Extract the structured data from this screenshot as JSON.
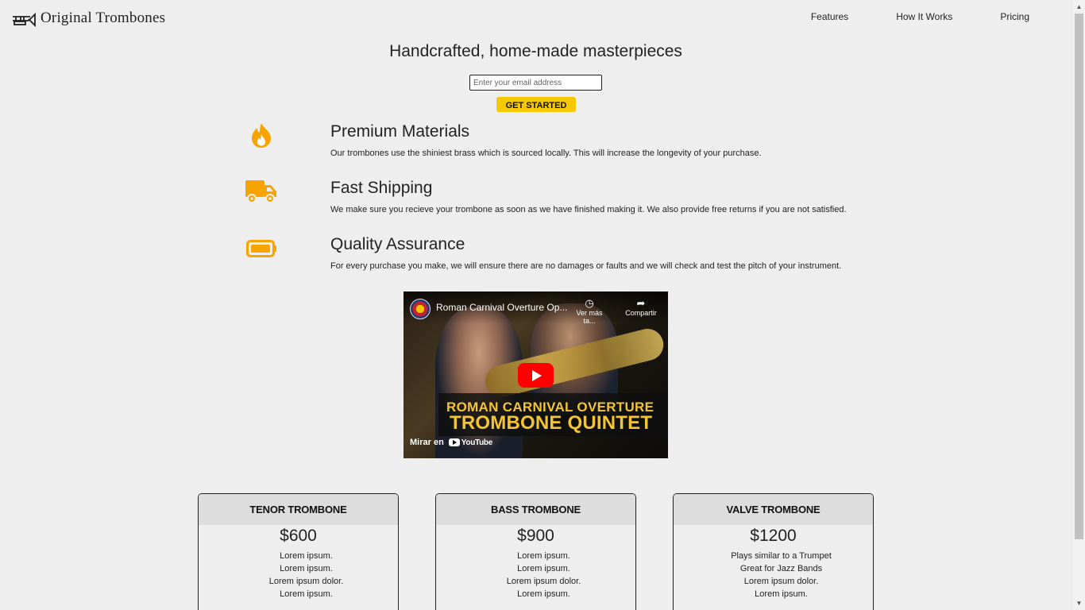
{
  "header": {
    "brand": "Original Trombones",
    "logo_icon": "trombone-icon",
    "nav": [
      {
        "label": "Features"
      },
      {
        "label": "How It Works"
      },
      {
        "label": "Pricing"
      }
    ]
  },
  "hero": {
    "title": "Handcrafted, home-made masterpieces",
    "email_placeholder": "Enter your email address",
    "cta_label": "GET STARTED"
  },
  "features": [
    {
      "icon": "fire-icon",
      "title": "Premium Materials",
      "description": "Our trombones use the shiniest brass which is sourced locally. This will increase the longevity of your purchase."
    },
    {
      "icon": "truck-icon",
      "title": "Fast Shipping",
      "description": "We make sure you recieve your trombone as soon as we have finished making it. We also provide free returns if you are not satisfied."
    },
    {
      "icon": "battery-icon",
      "title": "Quality Assurance",
      "description": "For every purchase you make, we will ensure there are no damages or faults and we will check and test the pitch of your instrument."
    }
  ],
  "video": {
    "title": "Roman Carnival Overture Op...",
    "watch_later": "Ver más ta...",
    "share": "Compartir",
    "banner_line1": "ROMAN CARNIVAL OVERTURE",
    "banner_line2": "TROMBONE QUINTET",
    "watch_on": "Mirar en",
    "platform": "YouTube"
  },
  "pricing": [
    {
      "name": "TENOR TROMBONE",
      "price": "$600",
      "features": [
        "Lorem ipsum.",
        "Lorem ipsum.",
        "Lorem ipsum dolor.",
        "Lorem ipsum."
      ]
    },
    {
      "name": "BASS TROMBONE",
      "price": "$900",
      "features": [
        "Lorem ipsum.",
        "Lorem ipsum.",
        "Lorem ipsum dolor.",
        "Lorem ipsum."
      ]
    },
    {
      "name": "VALVE TROMBONE",
      "price": "$1200",
      "features": [
        "Plays similar to a Trumpet",
        "Great for Jazz Bands",
        "Lorem ipsum dolor.",
        "Lorem ipsum."
      ]
    }
  ],
  "colors": {
    "accent": "#f7a400",
    "cta": "#f5c800",
    "background": "#eeeeee"
  }
}
